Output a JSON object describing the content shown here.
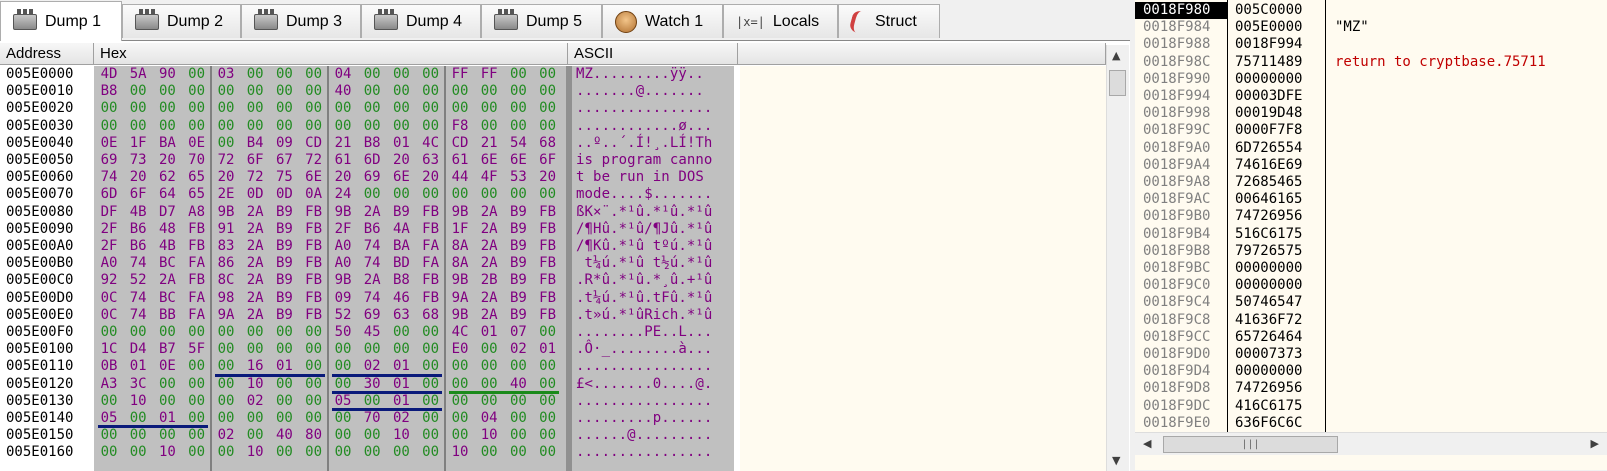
{
  "tabs": [
    {
      "label": "Dump 1",
      "icon": "dump-icon",
      "active": true
    },
    {
      "label": "Dump 2",
      "icon": "dump-icon"
    },
    {
      "label": "Dump 3",
      "icon": "dump-icon"
    },
    {
      "label": "Dump 4",
      "icon": "dump-icon"
    },
    {
      "label": "Dump 5",
      "icon": "dump-icon"
    },
    {
      "label": "Watch 1",
      "icon": "watch-icon"
    },
    {
      "label": "Locals",
      "icon": "locals-icon",
      "icon_text": "|x=|"
    },
    {
      "label": "Struct",
      "icon": "struct-icon"
    }
  ],
  "dump": {
    "headers": {
      "address": "Address",
      "hex": "Hex",
      "ascii": "ASCII"
    },
    "colors": {
      "zero": "#228b22",
      "nonzero": "#800080",
      "byte_default": "#808080",
      "hex_bg": "#c0c0c0"
    },
    "rows": [
      {
        "addr": "005E0000",
        "bytes": [
          "4D",
          "5A",
          "90",
          "00",
          "03",
          "00",
          "00",
          "00",
          "04",
          "00",
          "00",
          "00",
          "FF",
          "FF",
          "00",
          "00"
        ],
        "ascii": "MZ.........ÿÿ.."
      },
      {
        "addr": "005E0010",
        "bytes": [
          "B8",
          "00",
          "00",
          "00",
          "00",
          "00",
          "00",
          "00",
          "40",
          "00",
          "00",
          "00",
          "00",
          "00",
          "00",
          "00"
        ],
        "ascii": ".......@......."
      },
      {
        "addr": "005E0020",
        "bytes": [
          "00",
          "00",
          "00",
          "00",
          "00",
          "00",
          "00",
          "00",
          "00",
          "00",
          "00",
          "00",
          "00",
          "00",
          "00",
          "00"
        ],
        "ascii": "................"
      },
      {
        "addr": "005E0030",
        "bytes": [
          "00",
          "00",
          "00",
          "00",
          "00",
          "00",
          "00",
          "00",
          "00",
          "00",
          "00",
          "00",
          "F8",
          "00",
          "00",
          "00"
        ],
        "ascii": "............ø..."
      },
      {
        "addr": "005E0040",
        "bytes": [
          "0E",
          "1F",
          "BA",
          "0E",
          "00",
          "B4",
          "09",
          "CD",
          "21",
          "B8",
          "01",
          "4C",
          "CD",
          "21",
          "54",
          "68"
        ],
        "ascii": "..º..´.Í!¸.LÍ!Th"
      },
      {
        "addr": "005E0050",
        "bytes": [
          "69",
          "73",
          "20",
          "70",
          "72",
          "6F",
          "67",
          "72",
          "61",
          "6D",
          "20",
          "63",
          "61",
          "6E",
          "6E",
          "6F"
        ],
        "ascii": "is program canno"
      },
      {
        "addr": "005E0060",
        "bytes": [
          "74",
          "20",
          "62",
          "65",
          "20",
          "72",
          "75",
          "6E",
          "20",
          "69",
          "6E",
          "20",
          "44",
          "4F",
          "53",
          "20"
        ],
        "ascii": "t be run in DOS "
      },
      {
        "addr": "005E0070",
        "bytes": [
          "6D",
          "6F",
          "64",
          "65",
          "2E",
          "0D",
          "0D",
          "0A",
          "24",
          "00",
          "00",
          "00",
          "00",
          "00",
          "00",
          "00"
        ],
        "ascii": "mode....$......."
      },
      {
        "addr": "005E0080",
        "bytes": [
          "DF",
          "4B",
          "D7",
          "A8",
          "9B",
          "2A",
          "B9",
          "FB",
          "9B",
          "2A",
          "B9",
          "FB",
          "9B",
          "2A",
          "B9",
          "FB"
        ],
        "ascii": "ßK×¨.*¹û.*¹û.*¹û"
      },
      {
        "addr": "005E0090",
        "bytes": [
          "2F",
          "B6",
          "48",
          "FB",
          "91",
          "2A",
          "B9",
          "FB",
          "2F",
          "B6",
          "4A",
          "FB",
          "1F",
          "2A",
          "B9",
          "FB"
        ],
        "ascii": "/¶Hû.*¹û/¶Jû.*¹û"
      },
      {
        "addr": "005E00A0",
        "bytes": [
          "2F",
          "B6",
          "4B",
          "FB",
          "83",
          "2A",
          "B9",
          "FB",
          "A0",
          "74",
          "BA",
          "FA",
          "8A",
          "2A",
          "B9",
          "FB"
        ],
        "ascii": "/¶Kû.*¹û tºú.*¹û"
      },
      {
        "addr": "005E00B0",
        "bytes": [
          "A0",
          "74",
          "BC",
          "FA",
          "86",
          "2A",
          "B9",
          "FB",
          "A0",
          "74",
          "BD",
          "FA",
          "8A",
          "2A",
          "B9",
          "FB"
        ],
        "ascii": " t¼ú.*¹û t½ú.*¹û"
      },
      {
        "addr": "005E00C0",
        "bytes": [
          "92",
          "52",
          "2A",
          "FB",
          "8C",
          "2A",
          "B9",
          "FB",
          "9B",
          "2A",
          "B8",
          "FB",
          "9B",
          "2B",
          "B9",
          "FB"
        ],
        "ascii": ".R*û.*¹û.*¸û.+¹û"
      },
      {
        "addr": "005E00D0",
        "bytes": [
          "0C",
          "74",
          "BC",
          "FA",
          "98",
          "2A",
          "B9",
          "FB",
          "09",
          "74",
          "46",
          "FB",
          "9A",
          "2A",
          "B9",
          "FB"
        ],
        "ascii": ".t¼ú.*¹û.tFû.*¹û"
      },
      {
        "addr": "005E00E0",
        "bytes": [
          "0C",
          "74",
          "BB",
          "FA",
          "9A",
          "2A",
          "B9",
          "FB",
          "52",
          "69",
          "63",
          "68",
          "9B",
          "2A",
          "B9",
          "FB"
        ],
        "ascii": ".t»ú.*¹ûRich.*¹û"
      },
      {
        "addr": "005E00F0",
        "bytes": [
          "00",
          "00",
          "00",
          "00",
          "00",
          "00",
          "00",
          "00",
          "50",
          "45",
          "00",
          "00",
          "4C",
          "01",
          "07",
          "00"
        ],
        "ascii": "........PE..L..."
      },
      {
        "addr": "005E0100",
        "bytes": [
          "1C",
          "D4",
          "B7",
          "5F",
          "00",
          "00",
          "00",
          "00",
          "00",
          "00",
          "00",
          "00",
          "E0",
          "00",
          "02",
          "01"
        ],
        "ascii": ".Ô·_........à..."
      },
      {
        "addr": "005E0110",
        "bytes": [
          "0B",
          "01",
          "0E",
          "00",
          "00",
          "16",
          "01",
          "00",
          "00",
          "02",
          "01",
          "00",
          "00",
          "00",
          "00",
          "00"
        ],
        "ascii": "................"
      },
      {
        "addr": "005E0120",
        "bytes": [
          "A3",
          "3C",
          "00",
          "00",
          "00",
          "10",
          "00",
          "00",
          "00",
          "30",
          "01",
          "00",
          "00",
          "00",
          "40",
          "00"
        ],
        "ascii": "£<.......0....@."
      },
      {
        "addr": "005E0130",
        "bytes": [
          "00",
          "10",
          "00",
          "00",
          "00",
          "02",
          "00",
          "00",
          "05",
          "00",
          "01",
          "00",
          "00",
          "00",
          "00",
          "00"
        ],
        "ascii": "................"
      },
      {
        "addr": "005E0140",
        "bytes": [
          "05",
          "00",
          "01",
          "00",
          "00",
          "00",
          "00",
          "00",
          "00",
          "70",
          "02",
          "00",
          "00",
          "04",
          "00",
          "00"
        ],
        "ascii": ".........p......"
      },
      {
        "addr": "005E0150",
        "bytes": [
          "00",
          "00",
          "00",
          "00",
          "02",
          "00",
          "40",
          "80",
          "00",
          "00",
          "10",
          "00",
          "00",
          "10",
          "00",
          "00"
        ],
        "ascii": "......@........."
      },
      {
        "addr": "005E0160",
        "bytes": [
          "00",
          "00",
          "10",
          "00",
          "00",
          "10",
          "00",
          "00",
          "00",
          "00",
          "00",
          "00",
          "10",
          "00",
          "00",
          "00"
        ],
        "ascii": "................"
      }
    ],
    "underlines": [
      {
        "row": 17,
        "from": 4,
        "to": 7,
        "color": "#0a1a7a"
      },
      {
        "row": 17,
        "from": 8,
        "to": 11,
        "color": "#0a1a7a"
      },
      {
        "row": 18,
        "from": 8,
        "to": 11,
        "color": "#0a1a7a"
      },
      {
        "row": 18,
        "from": 12,
        "to": 15,
        "color": "#1a8a1a"
      },
      {
        "row": 19,
        "from": 8,
        "to": 11,
        "color": "#0a1a7a"
      },
      {
        "row": 20,
        "from": 0,
        "to": 3,
        "color": "#0a1a7a"
      }
    ]
  },
  "stack": {
    "rows": [
      {
        "addr": "0018F980",
        "value": "005C0000",
        "comment": "",
        "selected": true
      },
      {
        "addr": "0018F984",
        "value": "005E0000",
        "comment": "\"MZ\""
      },
      {
        "addr": "0018F988",
        "value": "0018F994",
        "comment": ""
      },
      {
        "addr": "0018F98C",
        "value": "75711489",
        "comment": "return to cryptbase.75711",
        "comment_color": "#c00000"
      },
      {
        "addr": "0018F990",
        "value": "00000000",
        "comment": ""
      },
      {
        "addr": "0018F994",
        "value": "00003DFE",
        "comment": ""
      },
      {
        "addr": "0018F998",
        "value": "00019D48",
        "comment": ""
      },
      {
        "addr": "0018F99C",
        "value": "0000F7F8",
        "comment": ""
      },
      {
        "addr": "0018F9A0",
        "value": "6D726554",
        "comment": ""
      },
      {
        "addr": "0018F9A4",
        "value": "74616E69",
        "comment": ""
      },
      {
        "addr": "0018F9A8",
        "value": "72685465",
        "comment": ""
      },
      {
        "addr": "0018F9AC",
        "value": "00646165",
        "comment": ""
      },
      {
        "addr": "0018F9B0",
        "value": "74726956",
        "comment": ""
      },
      {
        "addr": "0018F9B4",
        "value": "516C6175",
        "comment": ""
      },
      {
        "addr": "0018F9B8",
        "value": "79726575",
        "comment": ""
      },
      {
        "addr": "0018F9BC",
        "value": "00000000",
        "comment": ""
      },
      {
        "addr": "0018F9C0",
        "value": "00000000",
        "comment": ""
      },
      {
        "addr": "0018F9C4",
        "value": "50746547",
        "comment": ""
      },
      {
        "addr": "0018F9C8",
        "value": "41636F72",
        "comment": ""
      },
      {
        "addr": "0018F9CC",
        "value": "65726464",
        "comment": ""
      },
      {
        "addr": "0018F9D0",
        "value": "00007373",
        "comment": ""
      },
      {
        "addr": "0018F9D4",
        "value": "00000000",
        "comment": ""
      },
      {
        "addr": "0018F9D8",
        "value": "74726956",
        "comment": ""
      },
      {
        "addr": "0018F9DC",
        "value": "416C6175",
        "comment": ""
      },
      {
        "addr": "0018F9E0",
        "value": "636F6C6C",
        "comment": ""
      }
    ]
  }
}
